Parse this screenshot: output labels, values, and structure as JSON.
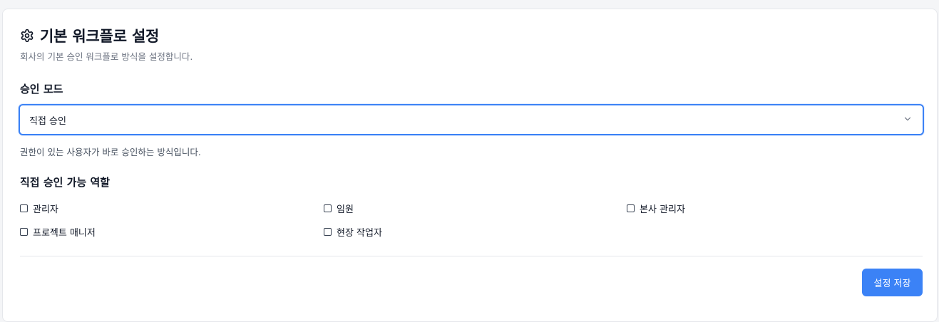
{
  "header": {
    "icon": "gear-icon",
    "title": "기본 워크플로 설정",
    "subtitle": "회사의 기본 승인 워크플로 방식을 설정합니다."
  },
  "approval_mode": {
    "label": "승인 모드",
    "selected": "직접 승인",
    "helper": "권한이 있는 사용자가 바로 승인하는 방식입니다."
  },
  "roles": {
    "label": "직접 승인 가능 역할",
    "items": [
      {
        "label": "관리자",
        "checked": false
      },
      {
        "label": "임원",
        "checked": false
      },
      {
        "label": "본사 관리자",
        "checked": false
      },
      {
        "label": "프로젝트 매니저",
        "checked": false
      },
      {
        "label": "현장 작업자",
        "checked": false
      }
    ]
  },
  "actions": {
    "save_label": "설정 저장"
  },
  "colors": {
    "accent": "#3b82f6"
  }
}
